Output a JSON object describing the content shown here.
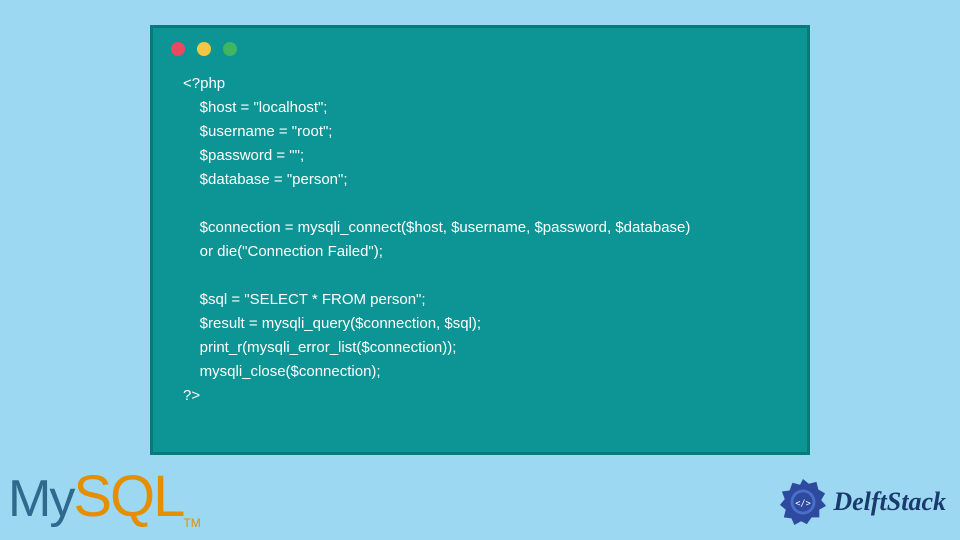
{
  "code": {
    "line1": "<?php",
    "line2": "    $host = \"localhost\";",
    "line3": "    $username = \"root\";",
    "line4": "    $password = \"\";",
    "line5": "    $database = \"person\";",
    "line6": "",
    "line7": "    $connection = mysqli_connect($host, $username, $password, $database)",
    "line8": "    or die(\"Connection Failed\");",
    "line9": "",
    "line10": "    $sql = \"SELECT * FROM person\";",
    "line11": "    $result = mysqli_query($connection, $sql);",
    "line12": "    print_r(mysqli_error_list($connection));",
    "line13": "    mysqli_close($connection);",
    "line14": "?>"
  },
  "logos": {
    "mysql_my": "My",
    "mysql_sql": "SQL",
    "mysql_tm": "TM",
    "delft": "DelftStack"
  },
  "colors": {
    "bg": "#9dd8f2",
    "window": "#0d9494",
    "red": "#e84a5f",
    "yellow": "#f7c744",
    "green": "#3fb65f"
  }
}
